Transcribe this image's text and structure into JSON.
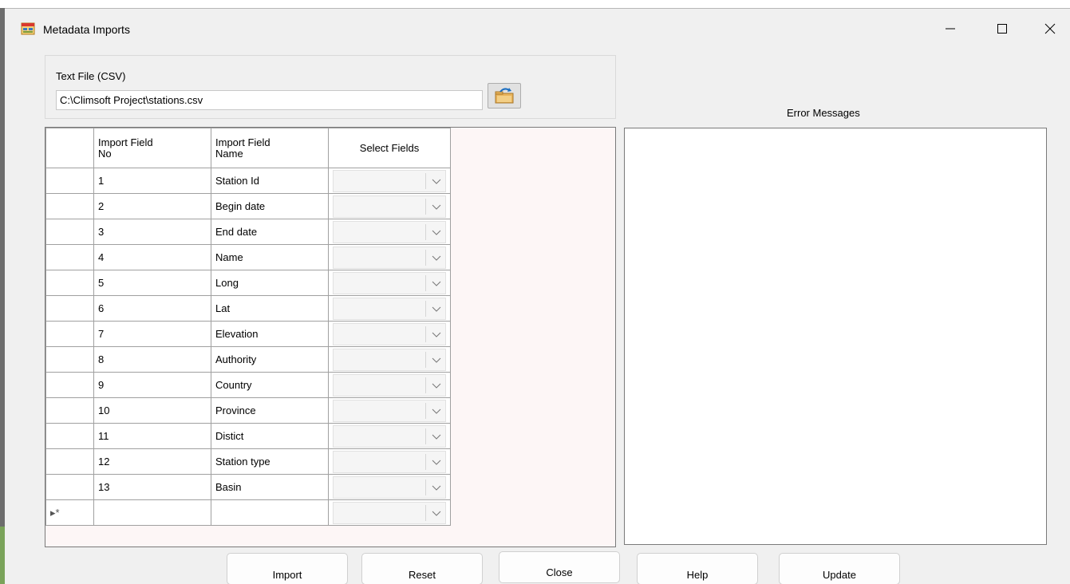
{
  "window": {
    "title": "Metadata Imports"
  },
  "file_panel": {
    "label": "Text File (CSV)",
    "path_value": "C:\\Climsoft Project\\stations.csv"
  },
  "error_panel": {
    "label": "Error Messages"
  },
  "grid": {
    "headers": {
      "field_no": [
        "Import Field",
        "No"
      ],
      "field_name": [
        "Import Field",
        "Name"
      ],
      "select": "Select Fields"
    },
    "rows": [
      {
        "no": "1",
        "name": "Station Id",
        "selected": ""
      },
      {
        "no": "2",
        "name": "Begin date",
        "selected": ""
      },
      {
        "no": "3",
        "name": "End date",
        "selected": ""
      },
      {
        "no": "4",
        "name": "Name",
        "selected": ""
      },
      {
        "no": "5",
        "name": "Long",
        "selected": ""
      },
      {
        "no": "6",
        "name": "Lat",
        "selected": ""
      },
      {
        "no": "7",
        "name": "Elevation",
        "selected": ""
      },
      {
        "no": "8",
        "name": "Authority",
        "selected": ""
      },
      {
        "no": "9",
        "name": "Country",
        "selected": ""
      },
      {
        "no": "10",
        "name": "Province",
        "selected": ""
      },
      {
        "no": "11",
        "name": "Distict",
        "selected": ""
      },
      {
        "no": "12",
        "name": "Station type",
        "selected": ""
      },
      {
        "no": "13",
        "name": "Basin",
        "selected": ""
      }
    ],
    "new_row_marker": "▸*"
  },
  "buttons": {
    "import": "Import",
    "reset": "Reset",
    "close": "Close",
    "help": "Help",
    "update": "Update"
  },
  "colors": {
    "window_bg": "#f0f0f0",
    "grid_panel_bg": "#fdf6f6",
    "border": "#7a7a7a"
  }
}
